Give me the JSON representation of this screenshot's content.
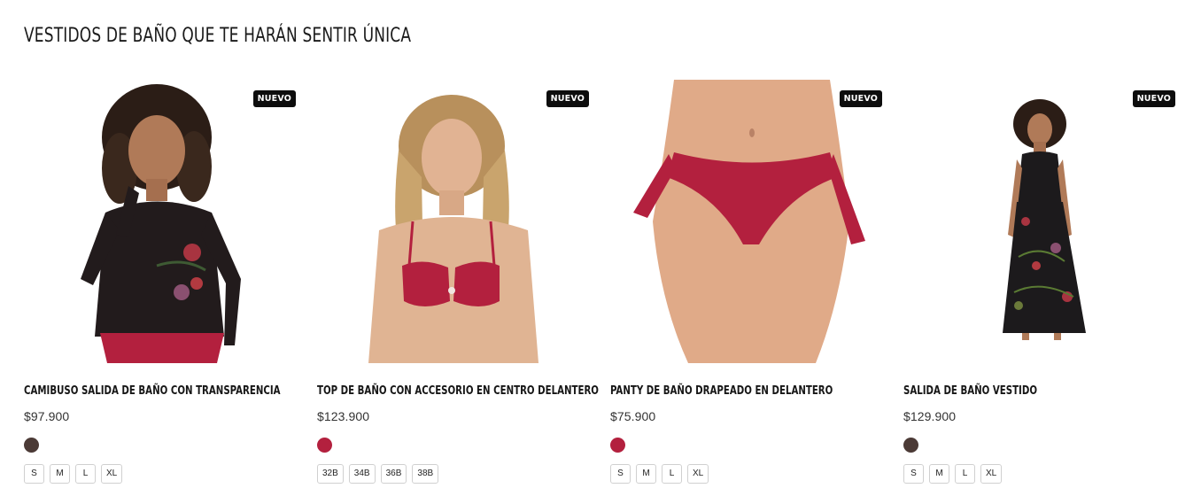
{
  "section": {
    "title": "VESTIDOS DE BAÑO QUE TE HARÁN SENTIR ÚNICA"
  },
  "products": [
    {
      "badge": "NUEVO",
      "name": "CAMIBUSO SALIDA DE BAÑO CON TRANSPARENCIA",
      "price": "$97.900",
      "swatches": [
        "#4b3a36"
      ],
      "sizes": [
        "S",
        "M",
        "L",
        "XL"
      ]
    },
    {
      "badge": "NUEVO",
      "name": "TOP DE BAÑO CON ACCESORIO EN CENTRO DELANTERO",
      "price": "$123.900",
      "swatches": [
        "#b3203e"
      ],
      "sizes": [
        "32B",
        "34B",
        "36B",
        "38B"
      ]
    },
    {
      "badge": "NUEVO",
      "name": "PANTY DE BAÑO DRAPEADO EN DELANTERO",
      "price": "$75.900",
      "swatches": [
        "#b3203e"
      ],
      "sizes": [
        "S",
        "M",
        "L",
        "XL"
      ]
    },
    {
      "badge": "NUEVO",
      "name": "SALIDA DE BAÑO VESTIDO",
      "price": "$129.900",
      "swatches": [
        "#4b3a36"
      ],
      "sizes": [
        "S",
        "M",
        "L",
        "XL"
      ]
    }
  ],
  "colors": {
    "badge_bg": "#0d0d0d",
    "swimwear_red": "#b3203e",
    "print_dark": "#1c1a1c"
  }
}
